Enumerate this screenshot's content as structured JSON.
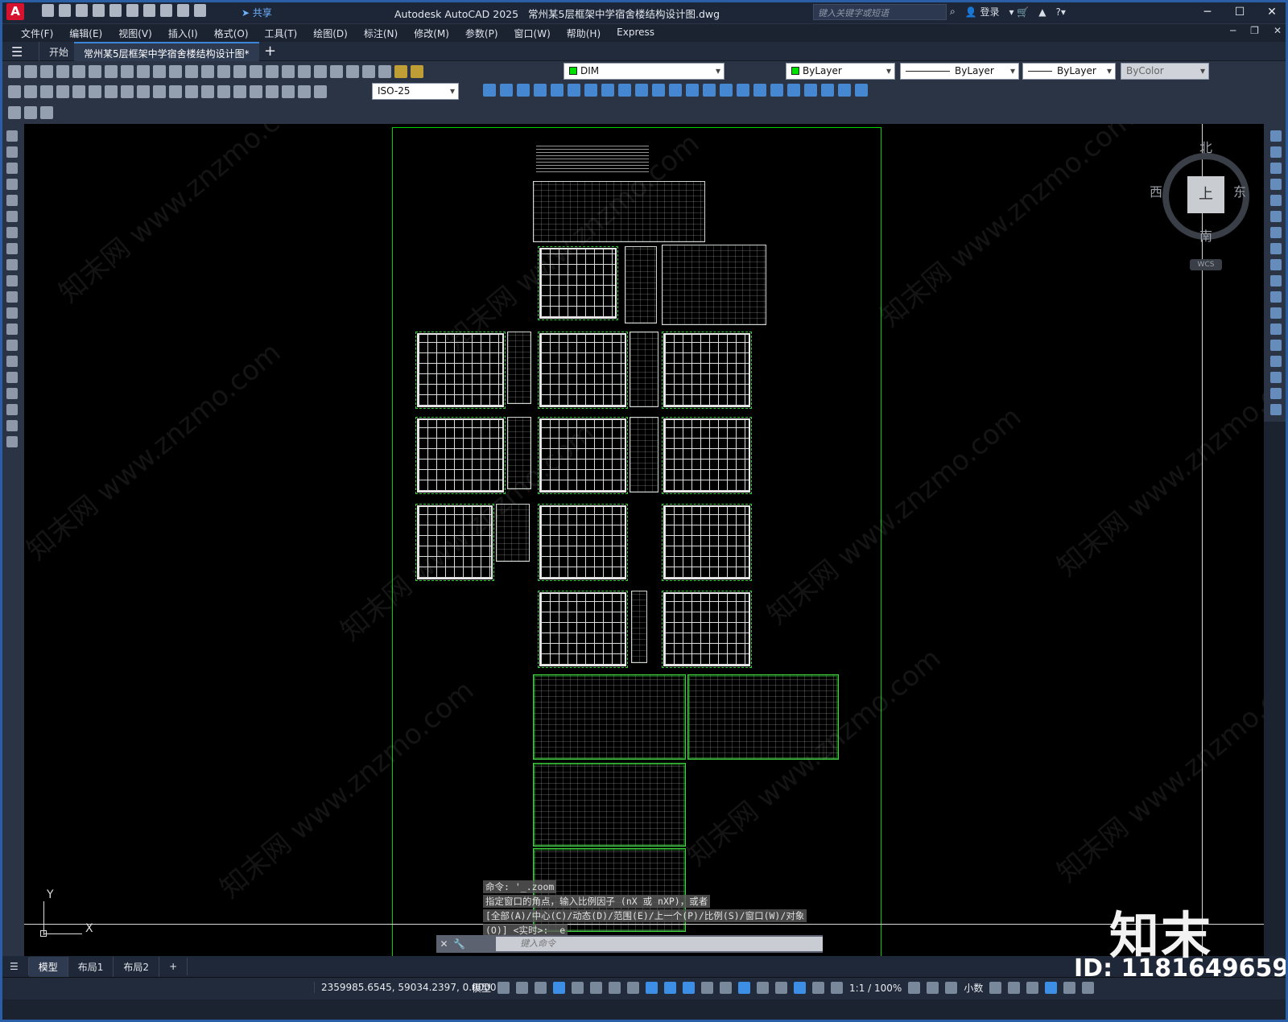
{
  "app": {
    "logo": "A",
    "title": "Autodesk AutoCAD 2025",
    "document": "常州某5层框架中学宿舍楼结构设计图.dwg",
    "share": "共享",
    "search_placeholder": "键入关键字或短语",
    "login": "登录"
  },
  "menu": [
    "文件(F)",
    "编辑(E)",
    "视图(V)",
    "插入(I)",
    "格式(O)",
    "工具(T)",
    "绘图(D)",
    "标注(N)",
    "修改(M)",
    "参数(P)",
    "窗口(W)",
    "帮助(H)",
    "Express"
  ],
  "tabs": {
    "start": "开始",
    "file": "常州某5层框架中学宿舍楼结构设计图*"
  },
  "properties": {
    "layer": "DIM",
    "color": "ByLayer",
    "linetype": "ByLayer",
    "lineweight": "ByLayer",
    "plotstyle": "ByColor",
    "dimstyle": "ISO-25"
  },
  "viewcube": {
    "north": "北",
    "south": "南",
    "east": "东",
    "west": "西",
    "face": "上",
    "wcs": "WCS"
  },
  "ucs": {
    "x": "X",
    "y": "Y"
  },
  "command": {
    "history": [
      "命令: '_.zoom",
      "指定窗口的角点，输入比例因子 (nX 或 nXP)，或者",
      "[全部(A)/中心(C)/动态(D)/范围(E)/上一个(P)/比例(S)/窗口(W)/对象",
      "(O)] <实时>: _e"
    ],
    "placeholder": "键入命令"
  },
  "layouts": [
    "模型",
    "布局1",
    "布局2"
  ],
  "status": {
    "coords": "2359985.6545, 59034.2397, 0.0000",
    "space": "模型",
    "scale": "1:1 / 100%",
    "units": "小数"
  },
  "watermark": {
    "text": "知末网 www.znzmo.com",
    "brand": "知末",
    "id": "ID: 1181649659"
  },
  "colors": {
    "accent": "#3a86d8",
    "paper_border": "#00d400",
    "layer_swatch": "#00e000"
  }
}
